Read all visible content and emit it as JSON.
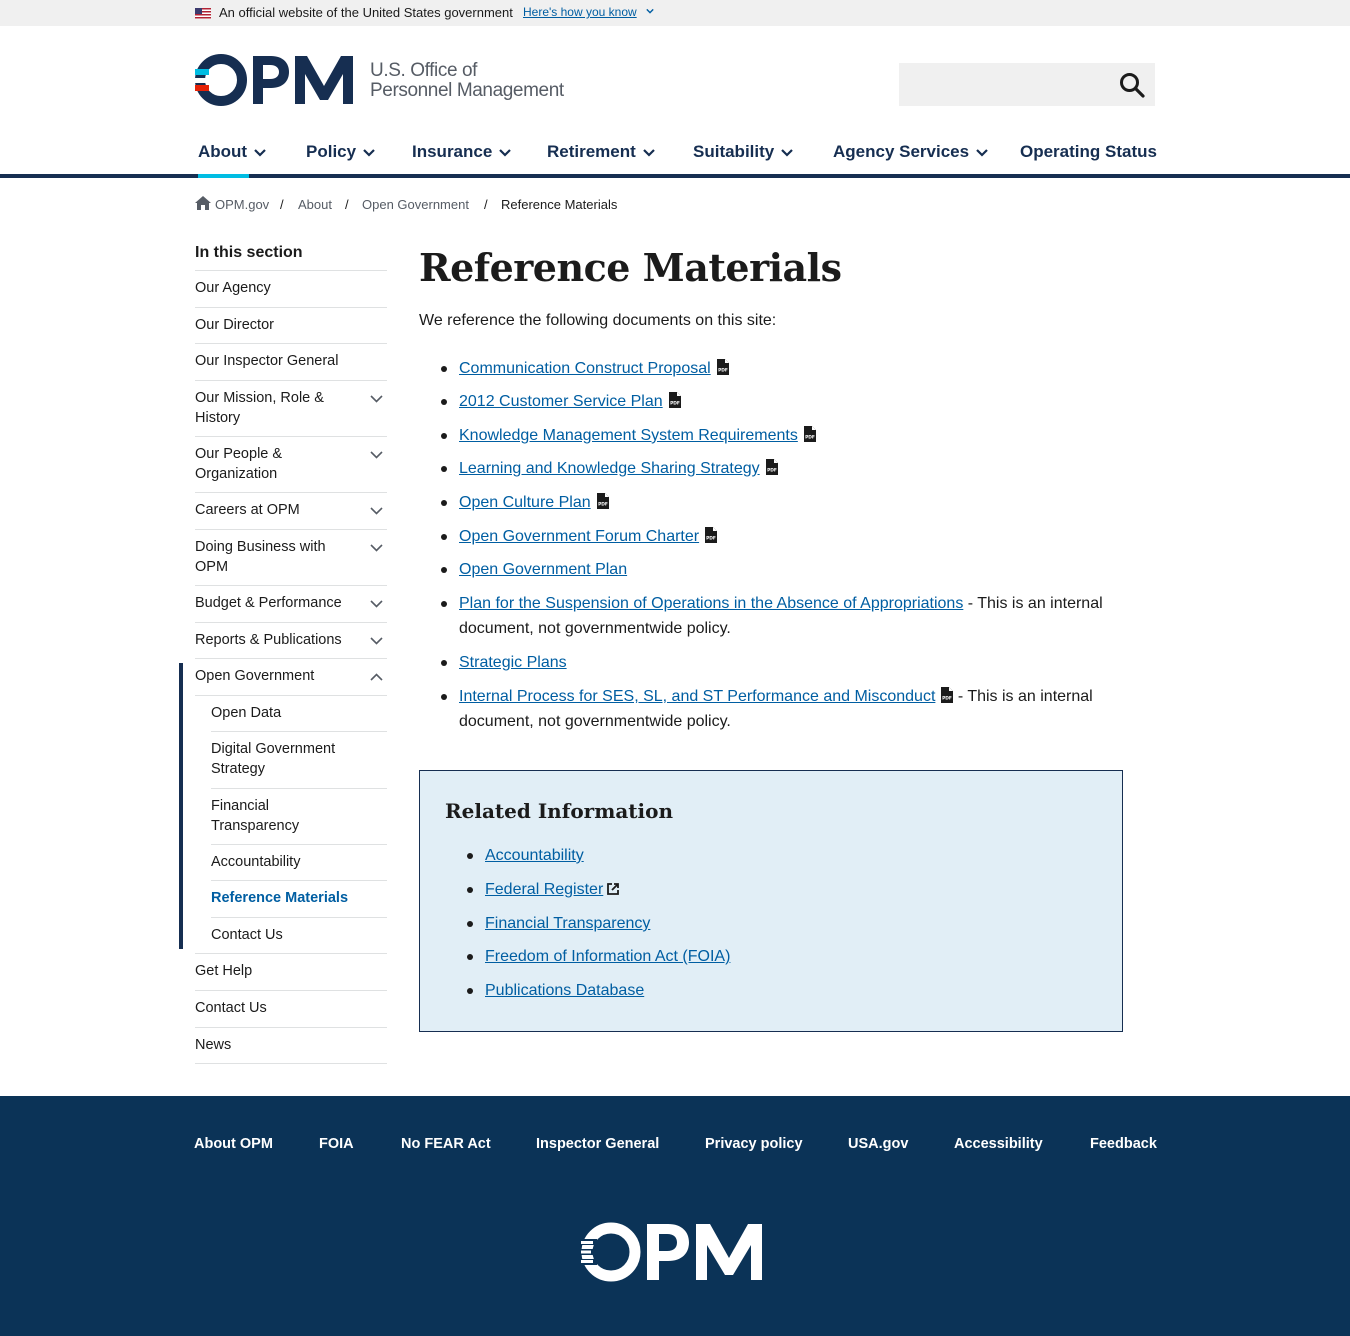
{
  "banner": {
    "official_text": "An official website of the United States government",
    "how_link": "Here's how you know"
  },
  "logo": {
    "line1": "U.S. Office of",
    "line2": "Personnel Management"
  },
  "search": {
    "placeholder": ""
  },
  "nav": [
    {
      "label": "About",
      "has_menu": true
    },
    {
      "label": "Policy",
      "has_menu": true
    },
    {
      "label": "Insurance",
      "has_menu": true
    },
    {
      "label": "Retirement",
      "has_menu": true
    },
    {
      "label": "Suitability",
      "has_menu": true
    },
    {
      "label": "Agency Services",
      "has_menu": true
    },
    {
      "label": "Operating Status",
      "has_menu": false
    }
  ],
  "breadcrumb": [
    "OPM.gov",
    "About",
    "Open Government",
    "Reference Materials"
  ],
  "sidebar": {
    "title": "In this section",
    "items": [
      {
        "label": "Our Agency"
      },
      {
        "label": "Our Director"
      },
      {
        "label": "Our Inspector General"
      },
      {
        "label": "Our Mission, Role & History"
      },
      {
        "label": "Our People & Organization"
      },
      {
        "label": "Careers at OPM"
      },
      {
        "label": "Doing Business with OPM"
      },
      {
        "label": "Budget & Performance"
      },
      {
        "label": "Reports & Publications"
      },
      {
        "label": "Open Government"
      },
      {
        "label": "Get Help"
      },
      {
        "label": "Contact Us"
      },
      {
        "label": "News"
      }
    ],
    "sub_items": [
      {
        "label": "Open Data"
      },
      {
        "label": "Digital Government Strategy"
      },
      {
        "label": "Financial Transparency"
      },
      {
        "label": "Accountability"
      },
      {
        "label": "Reference Materials"
      },
      {
        "label": "Contact Us"
      }
    ]
  },
  "main": {
    "title": "Reference Materials",
    "intro": "We reference the following documents on this site:",
    "docs": [
      {
        "label": "Communication Construct Proposal",
        "pdf": true,
        "note": ""
      },
      {
        "label": "2012 Customer Service Plan",
        "pdf": true,
        "note": ""
      },
      {
        "label": "Knowledge Management System Requirements",
        "pdf": true,
        "note": ""
      },
      {
        "label": "Learning and Knowledge Sharing Strategy",
        "pdf": true,
        "note": ""
      },
      {
        "label": "Open Culture Plan",
        "pdf": true,
        "note": ""
      },
      {
        "label": "Open Government Forum Charter",
        "pdf": true,
        "note": ""
      },
      {
        "label": "Open Government Plan",
        "pdf": false,
        "note": ""
      },
      {
        "label": "Plan for the Suspension of Operations in the Absence of Appropriations",
        "pdf": false,
        "note": " - This is an internal document, not governmentwide policy."
      },
      {
        "label": "Strategic Plans",
        "pdf": false,
        "note": ""
      },
      {
        "label": "Internal Process for SES, SL, and ST Performance and Misconduct",
        "pdf": true,
        "note": " - This is an internal document, not governmentwide policy."
      }
    ]
  },
  "related": {
    "title": "Related Information",
    "links": [
      {
        "label": "Accountability",
        "external": false
      },
      {
        "label": "Federal Register",
        "external": true
      },
      {
        "label": "Financial Transparency",
        "external": false
      },
      {
        "label": "Freedom of Information Act (FOIA)",
        "external": false
      },
      {
        "label": "Publications Database",
        "external": false
      }
    ]
  },
  "footer": {
    "links": [
      "About OPM",
      "FOIA",
      "No FEAR Act",
      "Inspector General",
      "Privacy policy",
      "USA.gov",
      "Accessibility",
      "Feedback"
    ]
  },
  "colors": {
    "link": "#005ea2",
    "navy": "#162e51",
    "footer": "#0b3357",
    "related_bg": "#e1eef6",
    "accent": "#00bde3"
  }
}
